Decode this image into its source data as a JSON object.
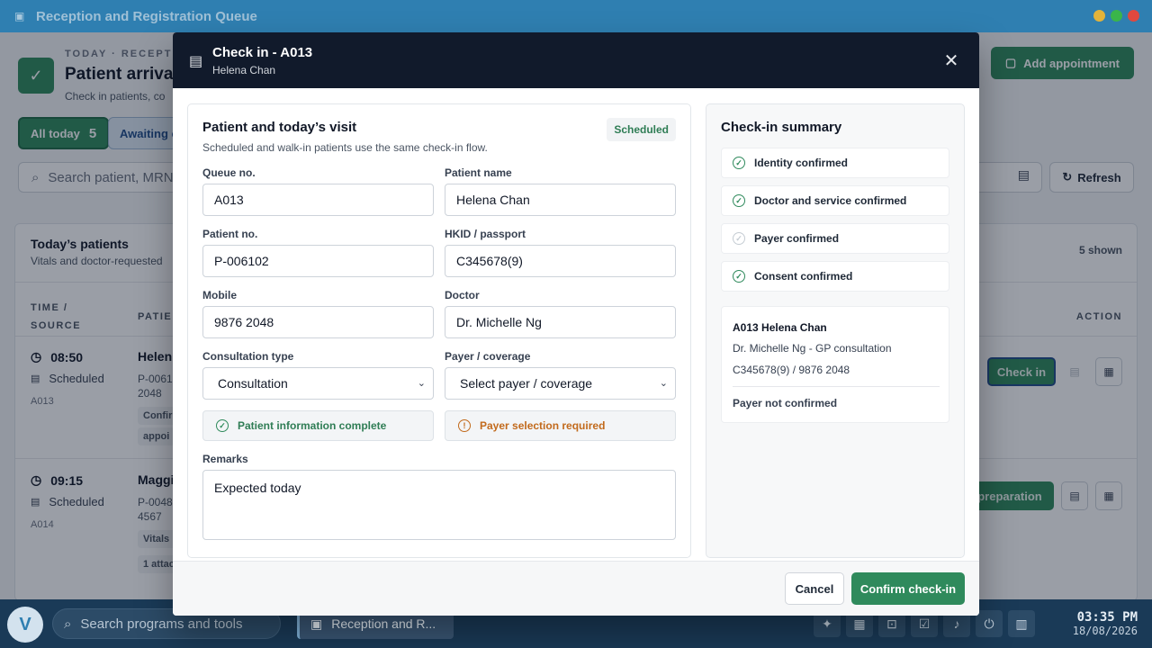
{
  "window": {
    "title": "Reception and Registration Queue"
  },
  "app": {
    "eyebrow": "TODAY · RECEPT",
    "title": "Patient arrivals",
    "subtitle": "Check in patients, co",
    "add_button": "Add appointment",
    "filters": {
      "all_label": "All today",
      "all_count": "5",
      "awaiting_label": "Awaiting c"
    },
    "search_placeholder": "Search patient, MRN",
    "refresh": "Refresh",
    "list": {
      "title": "Today’s patients",
      "subtitle": "Vitals and doctor-requested",
      "shown": "5 shown",
      "col_time": "TIME /",
      "col_source": "SOURCE",
      "col_patient": "PATIE",
      "col_action": "ACTION",
      "rows": [
        {
          "time": "08:50",
          "source": "Scheduled",
          "queue": "A013",
          "name": "Helen",
          "pno": "P-0061 2048",
          "tag1": "Confir",
          "tag2": "appoi",
          "action": "Check in"
        },
        {
          "time": "09:15",
          "source": "Scheduled",
          "queue": "A014",
          "name": "Maggi",
          "pno": "P-0048 4567",
          "tag1": "Vitals r",
          "tag2": "1 attac",
          "action": "preparation"
        }
      ]
    }
  },
  "modal": {
    "title": "Check in - A013",
    "subtitle": "Helena Chan",
    "visit": {
      "title": "Patient and today’s visit",
      "subtitle": "Scheduled and walk-in patients use the same check-in flow.",
      "badge": "Scheduled",
      "queue_label": "Queue no.",
      "queue_value": "A013",
      "name_label": "Patient name",
      "name_value": "Helena Chan",
      "pno_label": "Patient no.",
      "pno_value": "P-006102",
      "hkid_label": "HKID / passport",
      "hkid_value": "C345678(9)",
      "mobile_label": "Mobile",
      "mobile_value": "9876 2048",
      "doctor_label": "Doctor",
      "doctor_value": "Dr. Michelle Ng",
      "type_label": "Consultation type",
      "type_value": "Consultation",
      "payer_label": "Payer / coverage",
      "payer_value": "Select payer / coverage",
      "info_status": "Patient information complete",
      "payer_status": "Payer selection required",
      "remarks_label": "Remarks",
      "remarks_value": "Expected today"
    },
    "summary": {
      "title": "Check-in summary",
      "items": [
        {
          "label": "Identity confirmed",
          "done": true
        },
        {
          "label": "Doctor and service confirmed",
          "done": true
        },
        {
          "label": "Payer confirmed",
          "done": false
        },
        {
          "label": "Consent confirmed",
          "done": true
        }
      ],
      "name": "A013 Helena Chan",
      "line1": "Dr. Michelle Ng - GP consultation",
      "line2": "C345678(9) / 9876 2048",
      "payer": "Payer not confirmed"
    },
    "cancel": "Cancel",
    "confirm": "Confirm check-in"
  },
  "taskbar": {
    "search_placeholder": "Search programs and tools",
    "app_label": "Reception and R...",
    "time": "03:35 PM",
    "date": "18/08/2026"
  },
  "colors": {
    "accent": "#2f8a5c",
    "titlebar": "#2f7fb1",
    "modal_header": "#111a2b",
    "warning": "#c26a1c"
  }
}
